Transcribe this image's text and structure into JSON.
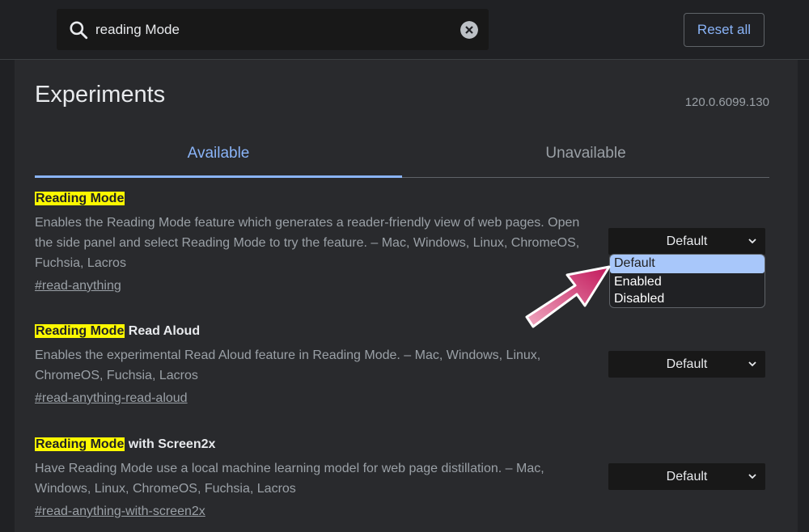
{
  "search": {
    "value": "reading Mode"
  },
  "header": {
    "reset_label": "Reset all"
  },
  "page": {
    "title": "Experiments",
    "version": "120.0.6099.130"
  },
  "tabs": [
    {
      "label": "Available",
      "active": true
    },
    {
      "label": "Unavailable",
      "active": false
    }
  ],
  "experiments": [
    {
      "title_highlight": "Reading Mode",
      "title_rest": "",
      "description": "Enables the Reading Mode feature which generates a reader-friendly view of web pages. Open the side panel and select Reading Mode to try the feature. – Mac, Windows, Linux, ChromeOS, Fuchsia, Lacros",
      "link": "#read-anything",
      "select_value": "Default"
    },
    {
      "title_highlight": "Reading Mode",
      "title_rest": " Read Aloud",
      "description": "Enables the experimental Read Aloud feature in Reading Mode. – Mac, Windows, Linux, ChromeOS, Fuchsia, Lacros",
      "link": "#read-anything-read-aloud",
      "select_value": "Default"
    },
    {
      "title_highlight": "Reading Mode",
      "title_rest": " with Screen2x",
      "description": "Have Reading Mode use a local machine learning model for web page distillation. – Mac, Windows, Linux, ChromeOS, Fuchsia, Lacros",
      "link": "#read-anything-with-screen2x",
      "select_value": "Default"
    }
  ],
  "dropdown": {
    "options": [
      "Default",
      "Enabled",
      "Disabled"
    ],
    "selected": "Default"
  },
  "colors": {
    "highlight": "#fcf800",
    "accent": "#8ab4f8",
    "arrow": "#c2185b",
    "background": "#202124"
  },
  "icons": [
    "search-icon",
    "clear-icon",
    "chevron-down-icon",
    "arrow-pointer-icon"
  ]
}
